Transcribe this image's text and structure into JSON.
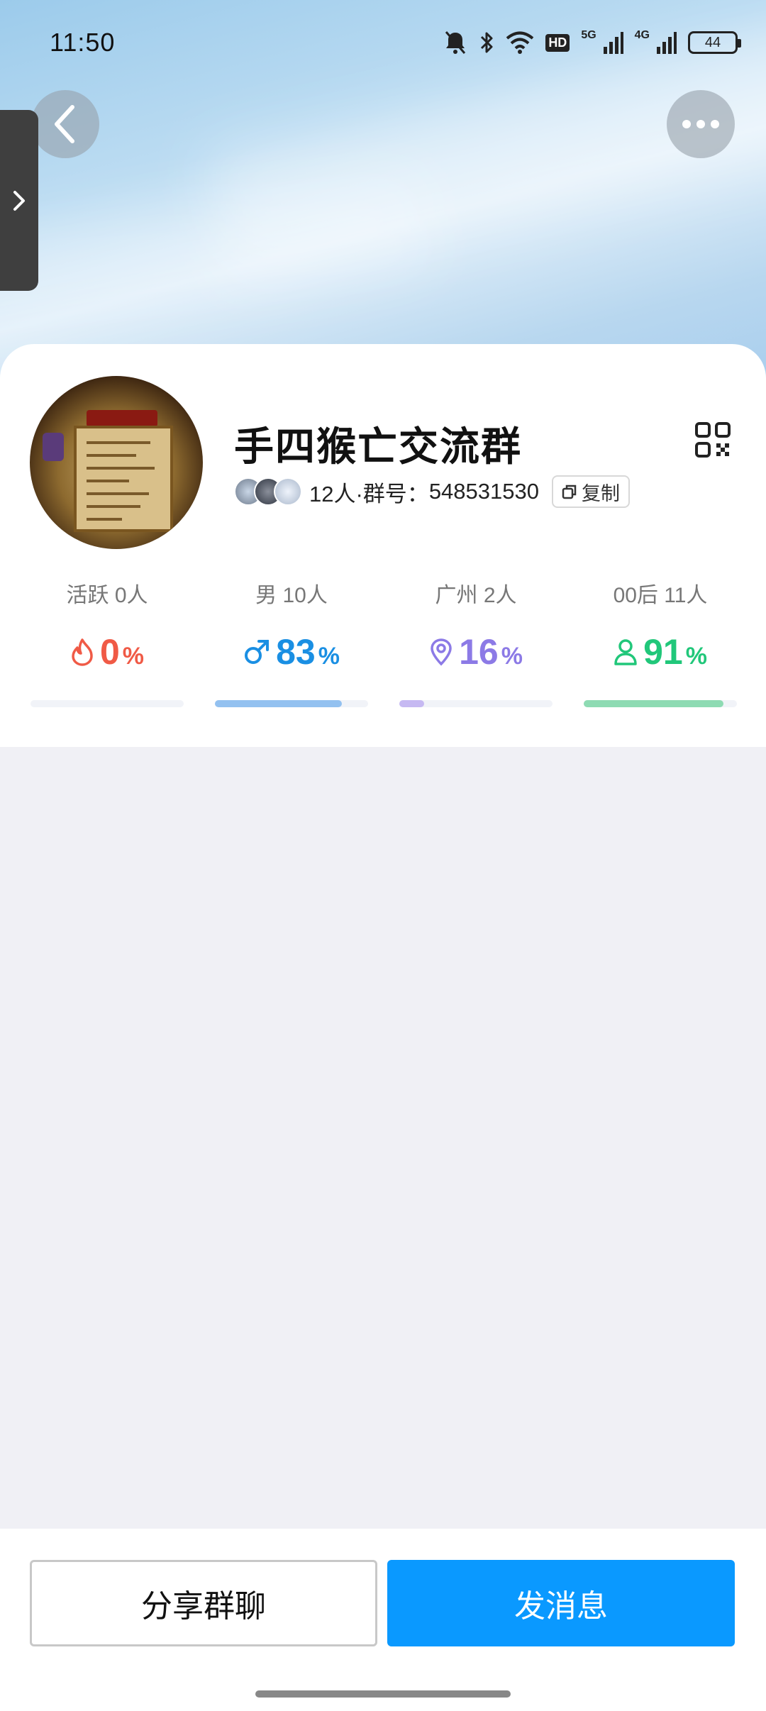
{
  "status_bar": {
    "time": "11:50",
    "hd_label": "HD",
    "sim1_label": "5G",
    "sim2_label": "4G",
    "battery": "44"
  },
  "group": {
    "name": "手四猴亡交流群",
    "members_text": "12人·群号：",
    "group_number": "548531530",
    "copy_label": "复制"
  },
  "stats": [
    {
      "label": "活跃 0人",
      "value": "0",
      "unit": "%",
      "percent": 0,
      "color": "#f05a46",
      "bar_color": "#f05a46",
      "icon": "flame-icon"
    },
    {
      "label": "男 10人",
      "value": "83",
      "unit": "%",
      "percent": 83,
      "color": "#1a8fe3",
      "bar_color": "#93c1f0",
      "icon": "male-icon"
    },
    {
      "label": "广州 2人",
      "value": "16",
      "unit": "%",
      "percent": 16,
      "color": "#8c7ae6",
      "bar_color": "#c6b9f2",
      "icon": "location-pin-icon"
    },
    {
      "label": "00后 11人",
      "value": "91",
      "unit": "%",
      "percent": 91,
      "color": "#21c77a",
      "bar_color": "#8edbb3",
      "icon": "person-icon"
    }
  ],
  "actions": {
    "share_label": "分享群聊",
    "send_label": "发消息"
  }
}
